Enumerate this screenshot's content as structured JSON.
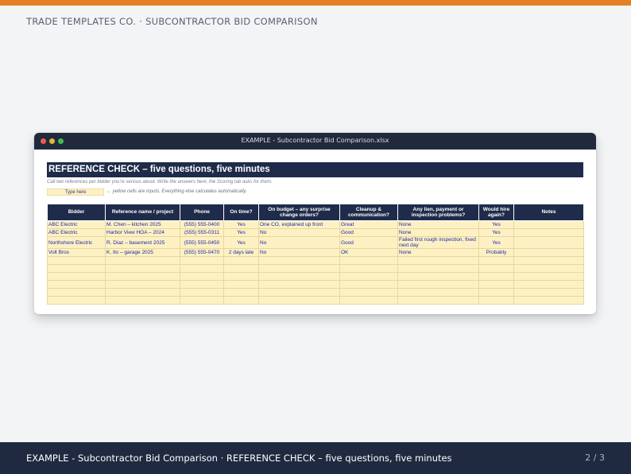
{
  "brand_line": "TRADE TEMPLATES CO.  ·  SUBCONTRACTOR BID COMPARISON",
  "window": {
    "title": "EXAMPLE - Subcontractor Bid Comparison.xlsx"
  },
  "sheet": {
    "banner": "REFERENCE CHECK – five questions, five minutes",
    "subnote": "Call two references per bidder you're serious about. Write the answers here; the Scoring tab asks for them.",
    "input_cell_label": "Type here",
    "legend_text": "← yellow cells are inputs. Everything else calculates automatically.",
    "headers": [
      "Bidder",
      "Reference name / project",
      "Phone",
      "On time?",
      "On budget – any surprise change orders?",
      "Cleanup & communication?",
      "Any lien, payment or inspection problems?",
      "Would hire again?",
      "Notes"
    ],
    "rows": [
      [
        "ABC Electric",
        "M. Chen – kitchen 2025",
        "(555) 555-0400",
        "Yes",
        "One CO, explained up front",
        "Great",
        "None",
        "Yes",
        ""
      ],
      [
        "ABC Electric",
        "Harbor View HOA – 2024",
        "(555) 555-0311",
        "Yes",
        "No",
        "Good",
        "None",
        "Yes",
        ""
      ],
      [
        "Northshore Electric",
        "R. Diaz – basement 2025",
        "(555) 555-0450",
        "Yes",
        "No",
        "Good",
        "Failed first rough inspection, fixed next day",
        "Yes",
        ""
      ],
      [
        "Volt Bros",
        "K. Ito – garage 2025",
        "(555) 555-0470",
        "2 days late",
        "No",
        "OK",
        "None",
        "Probably",
        ""
      ],
      [
        "",
        "",
        "",
        "",
        "",
        "",
        "",
        "",
        ""
      ],
      [
        "",
        "",
        "",
        "",
        "",
        "",
        "",
        "",
        ""
      ],
      [
        "",
        "",
        "",
        "",
        "",
        "",
        "",
        "",
        ""
      ],
      [
        "",
        "",
        "",
        "",
        "",
        "",
        "",
        "",
        ""
      ],
      [
        "",
        "",
        "",
        "",
        "",
        "",
        "",
        "",
        ""
      ],
      [
        "",
        "",
        "",
        "",
        "",
        "",
        "",
        "",
        ""
      ]
    ]
  },
  "footer": {
    "caption": "EXAMPLE - Subcontractor Bid Comparison · REFERENCE CHECK – five questions, five minutes",
    "page": "2 / 3"
  }
}
